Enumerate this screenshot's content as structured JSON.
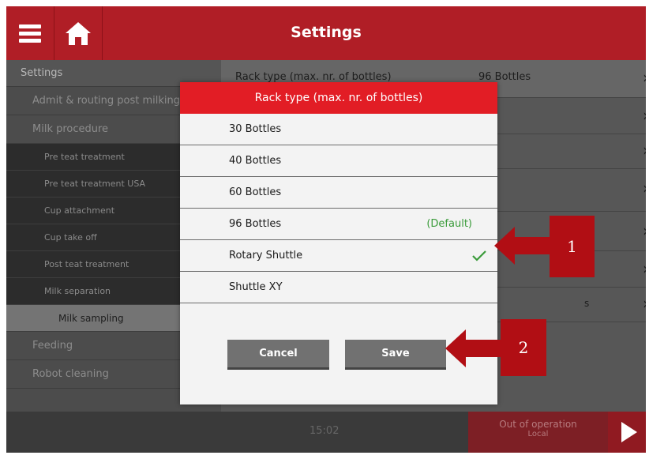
{
  "header": {
    "title": "Settings",
    "menu_icon": "hamburger-icon",
    "home_icon": "home-icon"
  },
  "sidebar": {
    "items": [
      {
        "label": "Settings",
        "level": "top"
      },
      {
        "label": "Admit & routing post milking",
        "level": "section"
      },
      {
        "label": "Milk procedure",
        "level": "section"
      },
      {
        "label": "Pre teat treatment",
        "level": "sub"
      },
      {
        "label": "Pre teat treatment USA",
        "level": "sub"
      },
      {
        "label": "Cup attachment",
        "level": "sub"
      },
      {
        "label": "Cup take off",
        "level": "sub"
      },
      {
        "label": "Post teat treatment",
        "level": "sub"
      },
      {
        "label": "Milk separation",
        "level": "sub"
      },
      {
        "label": "Milk sampling",
        "level": "selected"
      },
      {
        "label": "Feeding",
        "level": "section"
      },
      {
        "label": "Robot cleaning",
        "level": "section"
      }
    ]
  },
  "right_pane": {
    "row1_label": "Rack type (max. nr. of bottles)",
    "row1_value": "96 Bottles",
    "unit_s": "s"
  },
  "modal": {
    "title": "Rack type (max. nr. of bottles)",
    "options": [
      {
        "label": "30 Bottles"
      },
      {
        "label": "40 Bottles"
      },
      {
        "label": "60 Bottles"
      },
      {
        "label": "96 Bottles",
        "note": "(Default)"
      },
      {
        "label": "Rotary Shuttle",
        "selected": true
      },
      {
        "label": "Shuttle XY"
      }
    ],
    "cancel_label": "Cancel",
    "save_label": "Save"
  },
  "annotations": {
    "arrow1": "1",
    "arrow2": "2"
  },
  "status_bar": {
    "time": "15:02",
    "status": "Out of operation",
    "status_sub": "Local"
  },
  "colors": {
    "header_red": "#b01e26",
    "modal_header_red": "#e21d25",
    "check_green": "#3a9b3a",
    "annotation_red": "#b10e14"
  }
}
